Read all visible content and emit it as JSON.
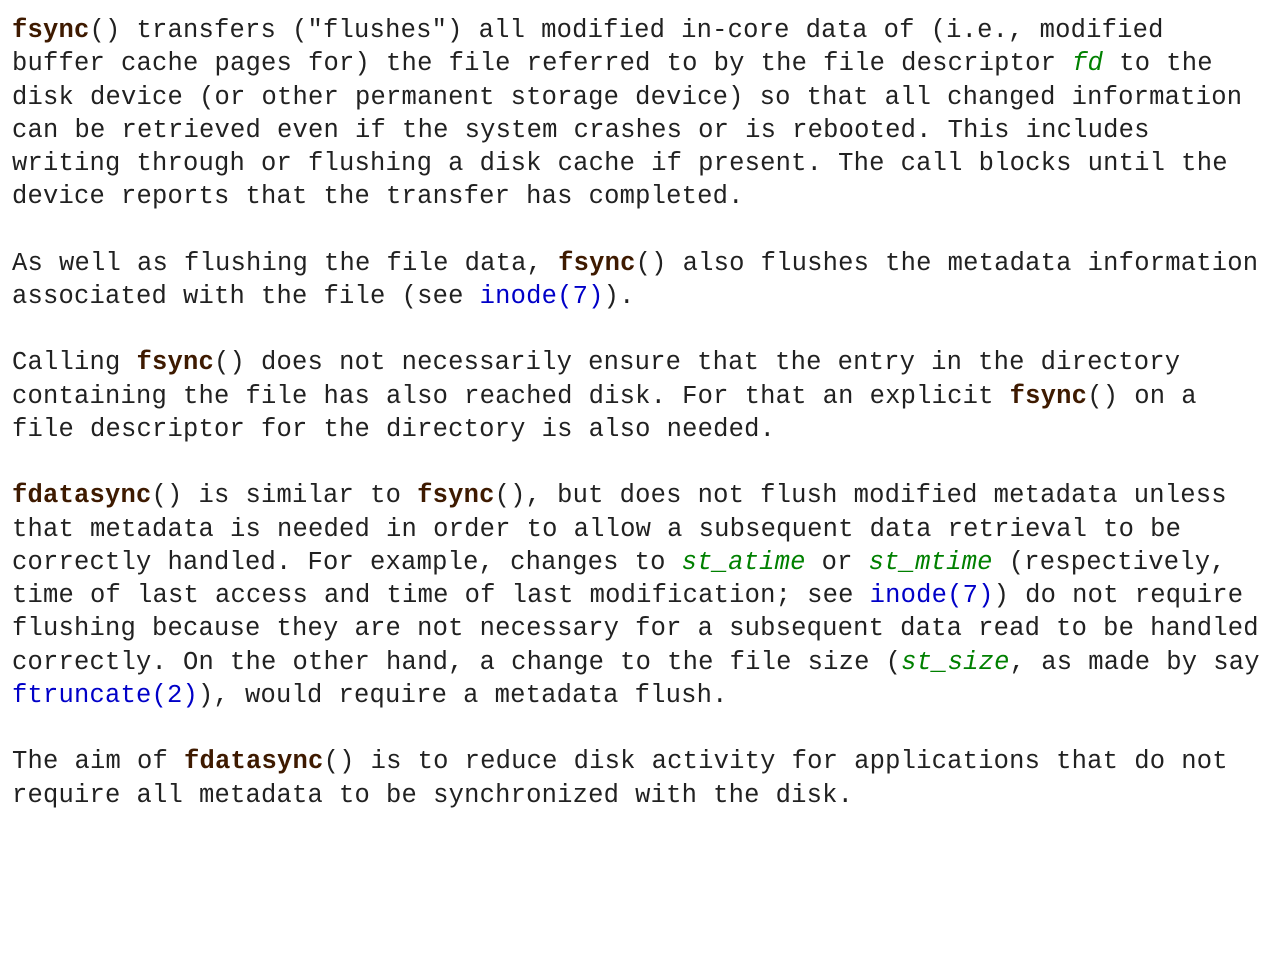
{
  "functions": {
    "fsync": "fsync",
    "fdatasync": "fdatasync"
  },
  "args": {
    "fd": "fd",
    "st_atime": "st_atime",
    "st_mtime": "st_mtime",
    "st_size": "st_size"
  },
  "links": {
    "inode7": "inode(7)",
    "ftruncate2": "ftruncate(2)"
  },
  "p1": {
    "t1": "() transfers (\"flushes\") all modified in-core data of (i.e., modified buffer cache pages for) the file referred to by the file descriptor ",
    "t2": " to the disk device (or other permanent storage device) so that all changed information can be retrieved even if the system crashes or is rebooted.  This includes writing through or flushing a disk cache if present.  The call blocks until the device reports that the transfer has completed."
  },
  "p2": {
    "t1": "As well as flushing the file data, ",
    "t2": "() also flushes the metadata information associated with the file (see ",
    "t3": ")."
  },
  "p3": {
    "t1": "Calling ",
    "t2": "() does not necessarily ensure that the entry in the directory containing the file has also reached disk.  For that an explicit ",
    "t3": "() on a file descriptor for the directory is also needed."
  },
  "p4": {
    "t1": "() is similar to ",
    "t2": "(), but does not flush modified metadata unless that metadata is needed in order to allow a subsequent data retrieval to be correctly handled.  For example, changes to ",
    "t3": " or ",
    "t4": " (respectively, time of last access and time of last modification; see ",
    "t5": ") do not require flushing because they are not necessary for a subsequent data read to be handled correctly.  On the other hand, a change to the file size (",
    "t6": ", as made by say ",
    "t7": "), would require a metadata flush."
  },
  "p5": {
    "t1": "The aim of ",
    "t2": "() is to reduce disk activity for applications that do not require all metadata to be synchronized with the disk."
  }
}
